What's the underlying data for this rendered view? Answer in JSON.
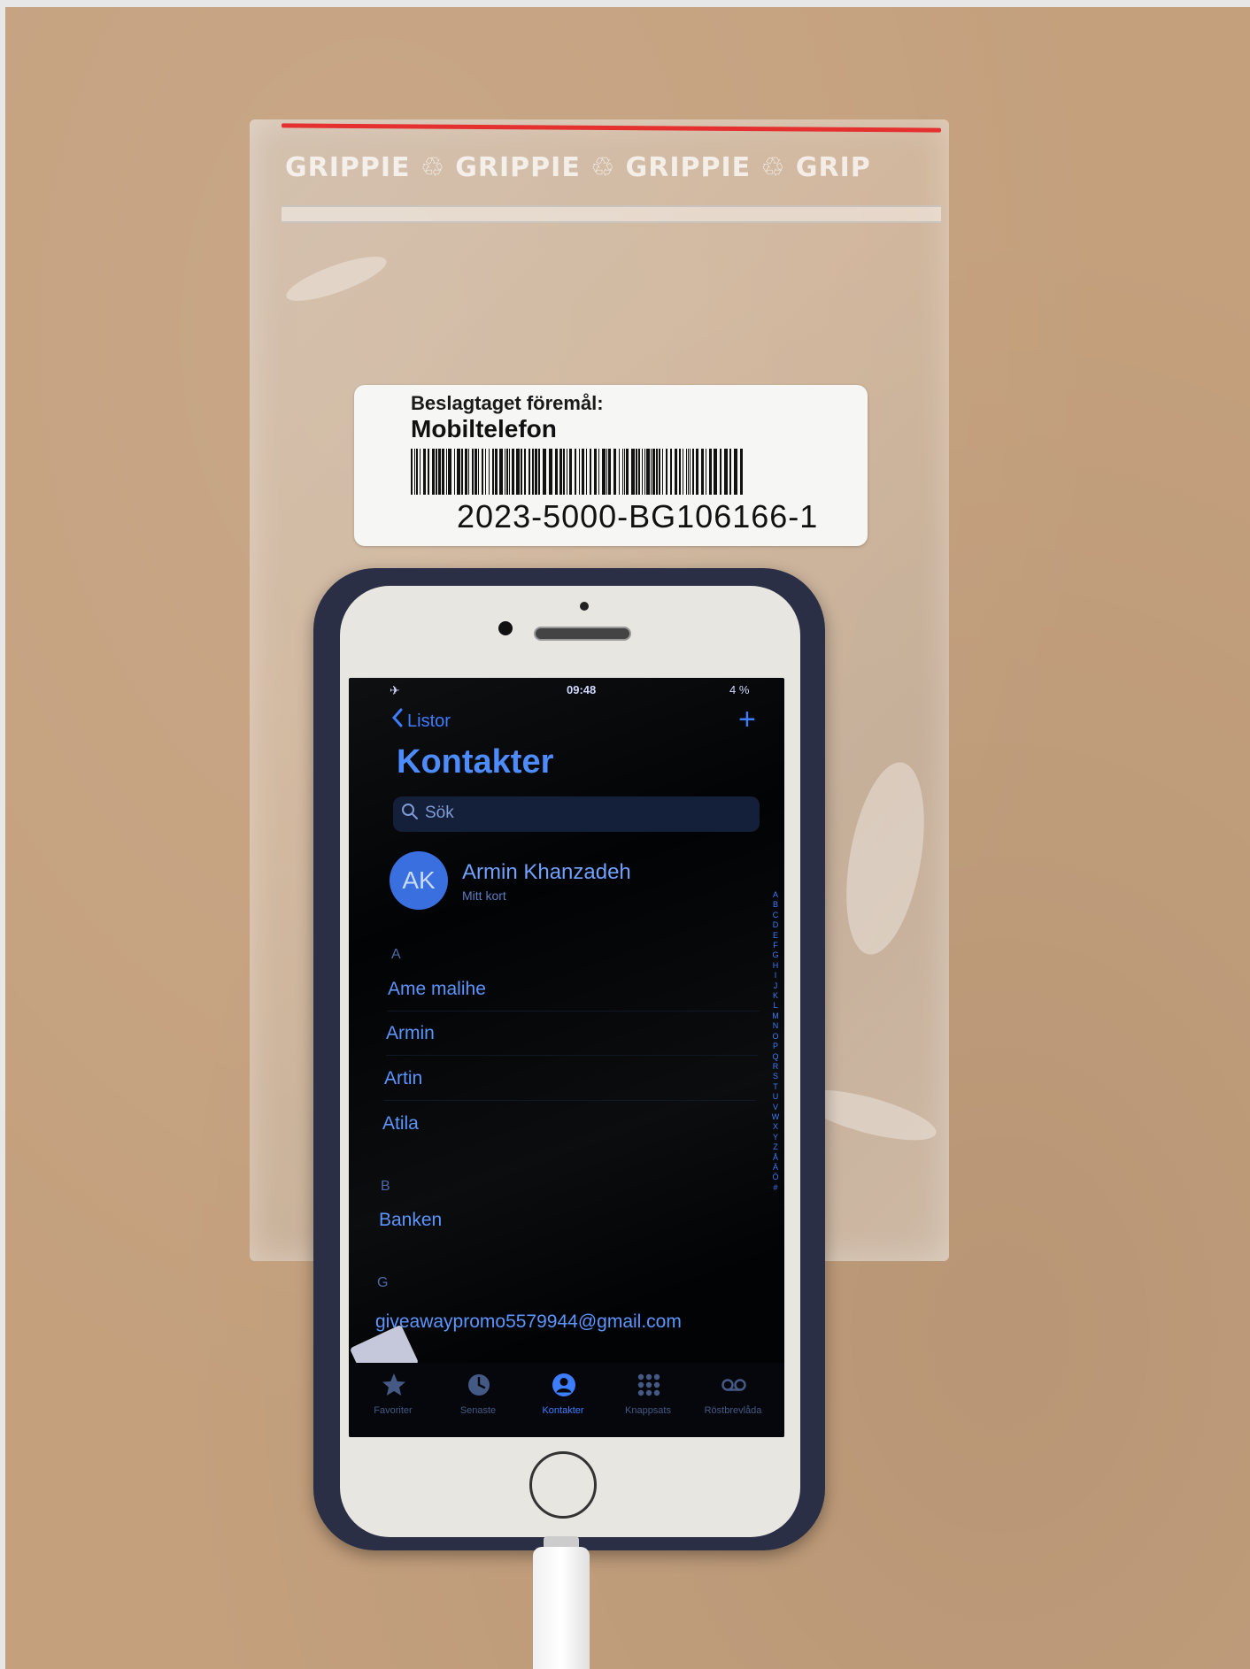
{
  "label": {
    "title": "Beslagtaget föremål:",
    "item": "Mobiltelefon",
    "number": "2023-5000-BG106166-1"
  },
  "bag": {
    "print": "GRIPPIE ♲ GRIPPIE ♲ GRIPPIE ♲ GRIP",
    "red_line_color": "#e53030"
  },
  "phone": {
    "status_bar": {
      "airplane_icon": "airplane-icon",
      "time": "09:48",
      "battery": "4 %"
    },
    "nav": {
      "back_label": "Listor",
      "add_label": "+"
    },
    "title": "Kontakter",
    "search": {
      "placeholder": "Sök"
    },
    "my_card": {
      "initials": "AK",
      "name": "Armin Khanzadeh",
      "subtitle": "Mitt kort"
    },
    "sections": [
      {
        "letter": "A",
        "contacts": [
          "Ame malihe",
          "Armin",
          "Artin",
          "Atila"
        ]
      },
      {
        "letter": "B",
        "contacts": [
          "Banken"
        ]
      },
      {
        "letter": "G",
        "contacts": [
          "giveawaypromo5579944@gmail.com"
        ]
      }
    ],
    "index": [
      "A",
      "B",
      "C",
      "D",
      "E",
      "F",
      "G",
      "H",
      "I",
      "J",
      "K",
      "L",
      "M",
      "N",
      "O",
      "P",
      "Q",
      "R",
      "S",
      "T",
      "U",
      "V",
      "W",
      "X",
      "Y",
      "Z",
      "Å",
      "Ä",
      "Ö",
      "#"
    ],
    "tabs": [
      {
        "label": "Favoriter",
        "icon": "star-icon",
        "active": false
      },
      {
        "label": "Senaste",
        "icon": "clock-icon",
        "active": false
      },
      {
        "label": "Kontakter",
        "icon": "contact-icon",
        "active": true
      },
      {
        "label": "Knappsats",
        "icon": "keypad-icon",
        "active": false
      },
      {
        "label": "Röstbrevlåda",
        "icon": "voicemail-icon",
        "active": false
      }
    ],
    "accent_color": "#3d7dff"
  }
}
